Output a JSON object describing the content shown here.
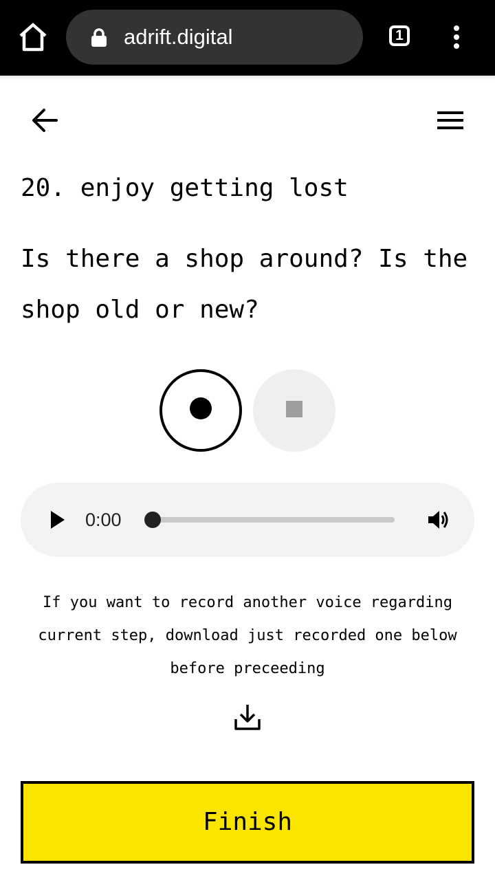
{
  "browser": {
    "url": "adrift.digital",
    "tab_count": "1",
    "home_icon": "home-icon",
    "lock_icon": "lock-icon",
    "menu_icon": "kebab-menu-icon"
  },
  "header": {
    "back_icon": "arrow-left-icon",
    "menu_icon": "hamburger-icon"
  },
  "step": {
    "title": "20. enjoy getting lost",
    "question": "Is there a shop around? Is the shop old or new?"
  },
  "recorder": {
    "record_icon": "record-icon",
    "stop_icon": "stop-icon",
    "stop_enabled": false
  },
  "player": {
    "time": "0:00",
    "progress": 0,
    "play_icon": "play-icon",
    "volume_icon": "volume-icon"
  },
  "note": "If you want to record another voice regarding current step, download just recorded one below before preceeding",
  "download_icon": "download-icon",
  "finish": {
    "label": "Finish",
    "color": "#fae500"
  }
}
